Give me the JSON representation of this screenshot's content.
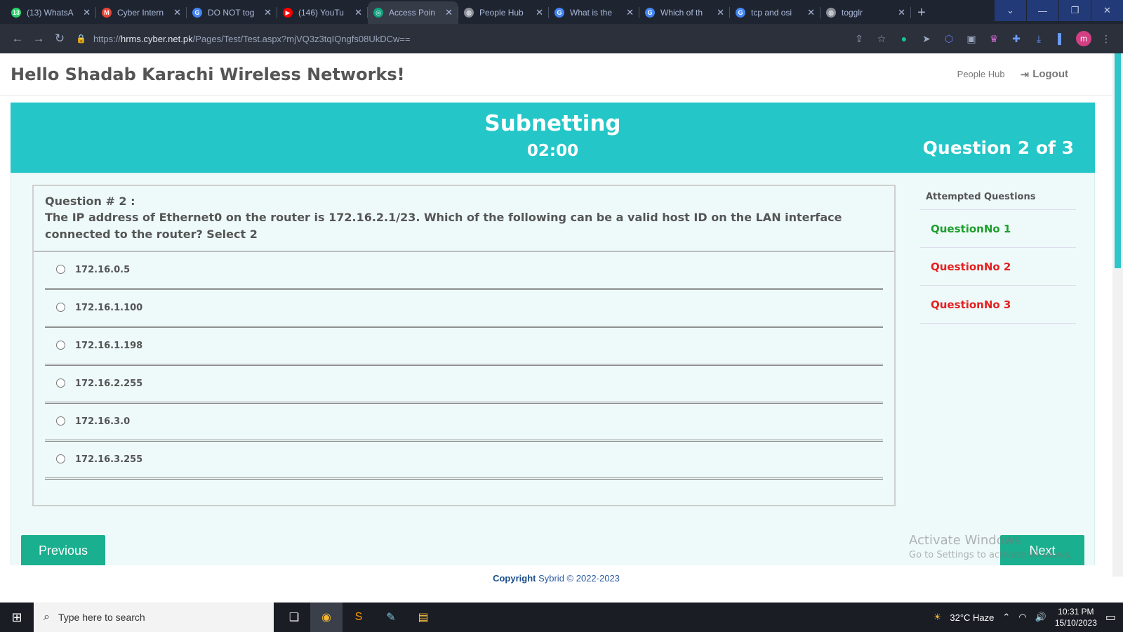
{
  "browser": {
    "tabs": [
      {
        "label": "(13) WhatsA",
        "icon": "whatsapp-icon",
        "color": "#25d366",
        "glyph": "13"
      },
      {
        "label": "Cyber Intern",
        "icon": "gmail-icon",
        "color": "#ea4335",
        "glyph": "M"
      },
      {
        "label": "DO NOT tog",
        "icon": "google-icon",
        "color": "#4285f4",
        "glyph": "G"
      },
      {
        "label": "(146) YouTu",
        "icon": "youtube-icon",
        "color": "#ff0000",
        "glyph": "▶"
      },
      {
        "label": "Access Poin",
        "icon": "chatgpt-icon",
        "color": "#10a37f",
        "glyph": "◎"
      },
      {
        "label": "People Hub",
        "icon": "globe-icon",
        "color": "#8a8f99",
        "glyph": "◍"
      },
      {
        "label": "What is the",
        "icon": "google-icon",
        "color": "#4285f4",
        "glyph": "G"
      },
      {
        "label": "Which of th",
        "icon": "google-icon",
        "color": "#4285f4",
        "glyph": "G"
      },
      {
        "label": "tcp and osi",
        "icon": "google-icon",
        "color": "#4285f4",
        "glyph": "G"
      },
      {
        "label": "togglr",
        "icon": "globe-icon",
        "color": "#8a8f99",
        "glyph": "◍"
      }
    ],
    "url_host": "hrms.cyber.net.pk",
    "url_scheme": "https://",
    "url_path": "/Pages/Test/Test.aspx?mjVQ3z3tqIQngfs08UkDCw==",
    "profile_initial": "m"
  },
  "topnav": {
    "greeting": "Hello Shadab Karachi Wireless Networks!",
    "people_hub": "People Hub",
    "logout": "Logout"
  },
  "test": {
    "title": "Subnetting",
    "timer": "02:00",
    "counter": "Question 2 of 3"
  },
  "question": {
    "number_label": "Question # 2 :",
    "text": "The IP address of Ethernet0 on the router is 172.16.2.1/23. Which of the following can be a valid host ID on the LAN interface connected to the router? Select 2",
    "options": [
      "172.16.0.5",
      "172.16.1.100",
      "172.16.1.198",
      "172.16.2.255",
      "172.16.3.0",
      "172.16.3.255"
    ]
  },
  "attempted": {
    "title": "Attempted Questions",
    "items": [
      {
        "label": "QuestionNo 1",
        "color": "#1e9e2e"
      },
      {
        "label": "QuestionNo 2",
        "color": "#e52020"
      },
      {
        "label": "QuestionNo 3",
        "color": "#e52020"
      }
    ]
  },
  "buttons": {
    "previous": "Previous",
    "next": "Next"
  },
  "watermark": {
    "line1": "Activate Windows",
    "line2": "Go to Settings to activate Windows."
  },
  "footer": {
    "label": "Copyright",
    "text": " Sybrid © 2022-2023"
  },
  "taskbar": {
    "search_placeholder": "Type here to search",
    "weather": "32°C  Haze",
    "time": "10:31 PM",
    "date": "15/10/2023"
  }
}
